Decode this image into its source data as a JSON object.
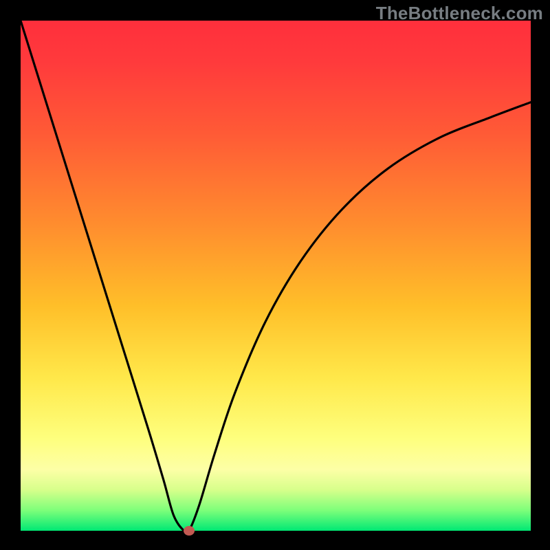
{
  "watermark": {
    "text": "TheBottleneck.com"
  },
  "chart_data": {
    "type": "line",
    "title": "",
    "xlabel": "",
    "ylabel": "",
    "xlim": [
      0,
      100
    ],
    "ylim": [
      0,
      100
    ],
    "series": [
      {
        "name": "curve",
        "x": [
          0,
          5,
          10,
          15,
          20,
          25,
          28,
          30,
          32,
          33,
          35,
          38,
          42,
          48,
          55,
          63,
          72,
          82,
          92,
          100
        ],
        "values": [
          100,
          84,
          68,
          52,
          36,
          20,
          10,
          3,
          0,
          0,
          5,
          15,
          27,
          41,
          53,
          63,
          71,
          77,
          81,
          84
        ]
      }
    ],
    "marker": {
      "x": 33,
      "y": 0,
      "color": "#c15a52"
    },
    "gradient_stops": [
      {
        "pos": 0,
        "color": "#ff2f3c"
      },
      {
        "pos": 40,
        "color": "#ff8d2e"
      },
      {
        "pos": 70,
        "color": "#ffe84a"
      },
      {
        "pos": 100,
        "color": "#00e874"
      }
    ]
  }
}
